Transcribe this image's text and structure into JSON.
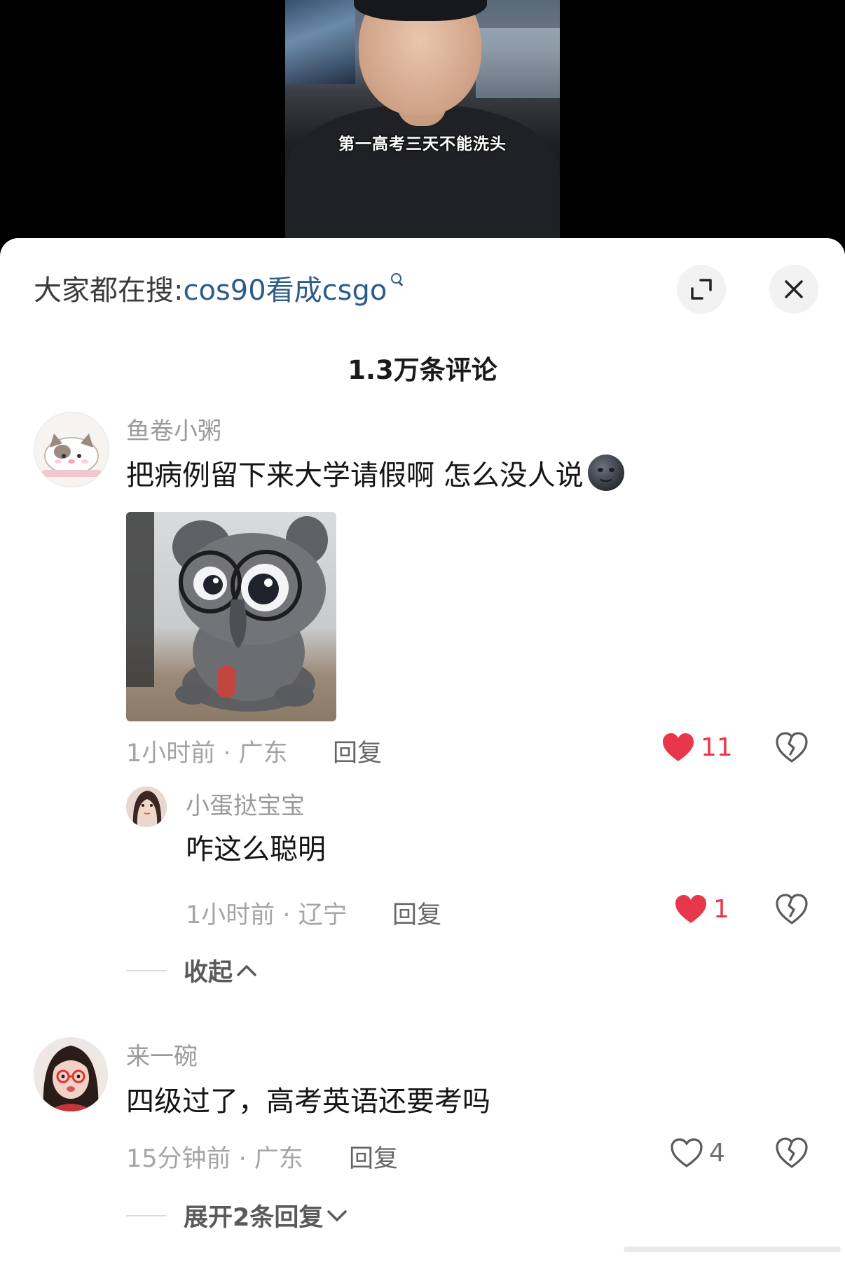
{
  "video": {
    "subtitle": "第一高考三天不能洗头"
  },
  "header": {
    "search_prefix": "大家都在搜:",
    "search_term": "cos90看成csgo",
    "expand_icon": "expand-icon",
    "close_icon": "close-icon",
    "comment_count": "1.3万条评论"
  },
  "comments": [
    {
      "username": "鱼卷小粥",
      "text": "把病例留下来大学请假啊 怎么没人说",
      "emoji": "new-moon-face-emoji",
      "has_image": true,
      "time": "1小时前",
      "location": "广东",
      "meta": "1小时前 · 广东",
      "reply_label": "回复",
      "likes": "11",
      "liked": true,
      "replies": [
        {
          "username": "小蛋挞宝宝",
          "text": "咋这么聪明",
          "meta": "1小时前 · 辽宁",
          "reply_label": "回复",
          "likes": "1",
          "liked": true
        }
      ],
      "fold_label": "收起"
    },
    {
      "username": "来一碗",
      "text": "四级过了，高考英语还要考吗",
      "meta": "15分钟前 · 广东",
      "reply_label": "回复",
      "likes": "4",
      "liked": false,
      "expand_label": "展开2条回复"
    }
  ],
  "colors": {
    "accent_like": "#e8364b",
    "search_link": "#2e5c8a"
  }
}
